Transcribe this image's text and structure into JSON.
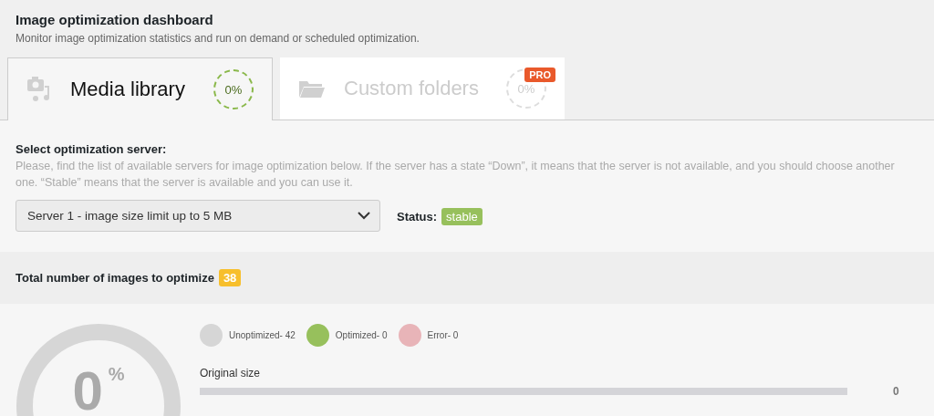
{
  "header": {
    "title": "Image optimization dashboard",
    "subtitle": "Monitor image optimization statistics and run on demand or scheduled optimization."
  },
  "tabs": [
    {
      "kind": "media",
      "label": "Media library",
      "progress": "0%",
      "selected": true
    },
    {
      "kind": "folders",
      "label": "Custom folders",
      "progress": "0%",
      "selected": false,
      "badge": "PRO"
    }
  ],
  "server": {
    "heading": "Select optimization server:",
    "help": "Please, find the list of available servers for image optimization below. If the server has a state “Down”, it means that the server is not available, and you should choose another one. “Stable” means that the server is available and you can use it.",
    "value": "Server 1 - image size limit up to 5 MB",
    "status_label": "Status:",
    "status": "stable"
  },
  "total": {
    "label": "Total number of images to optimize",
    "count": "38"
  },
  "legend": [
    {
      "label": "Unoptimized- 42",
      "color": "#d6d6d6"
    },
    {
      "label": "Optimized- 0",
      "color": "#97c05c"
    },
    {
      "label": "Error- 0",
      "color": "#e8b4b8"
    }
  ],
  "donut": {
    "value": "0",
    "unit": "%"
  },
  "sizes": [
    {
      "label": "Original size",
      "value": "0"
    }
  ]
}
